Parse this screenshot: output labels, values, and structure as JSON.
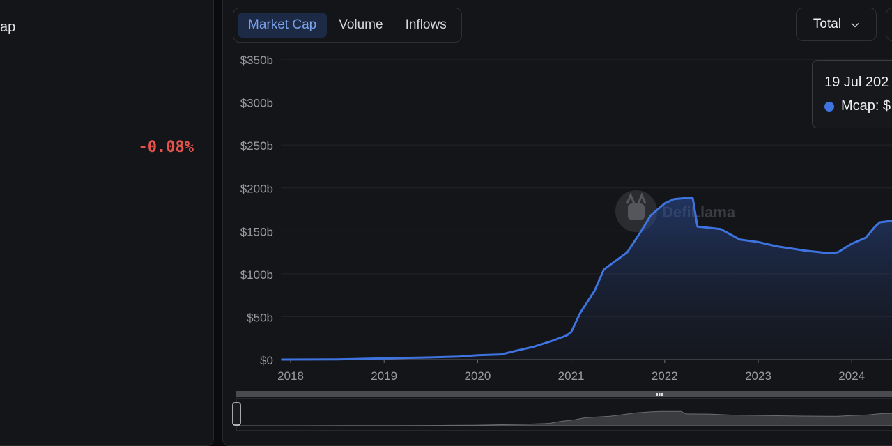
{
  "left": {
    "label": "ap",
    "change": "-0.08%"
  },
  "tabs": [
    {
      "label": "Market Cap",
      "active": true
    },
    {
      "label": "Volume",
      "active": false
    },
    {
      "label": "Inflows",
      "active": false
    }
  ],
  "total": {
    "label": "Total"
  },
  "tooltip": {
    "date": "19 Jul 202",
    "series": "Mcap: $"
  },
  "watermark": "DefiLlama",
  "colors": {
    "line": "#3e73e0",
    "negative": "#e5534b",
    "active_tab": "#7ba2ea"
  },
  "chart_data": {
    "type": "area",
    "yticks": [
      "$0",
      "$50b",
      "$100b",
      "$150b",
      "$200b",
      "$250b",
      "$300b",
      "$350b"
    ],
    "ylim": [
      0,
      350
    ],
    "xticks": [
      "2018",
      "2019",
      "2020",
      "2021",
      "2022",
      "2023",
      "2024"
    ],
    "xlim": [
      2017.9,
      2024.45
    ],
    "grid": true,
    "series": [
      {
        "x": [
          2017.9,
          2018.5,
          2019.0,
          2019.5,
          2019.8,
          2020.0,
          2020.25,
          2020.4,
          2020.6,
          2020.8,
          2020.95,
          2021.0,
          2021.1,
          2021.25,
          2021.35,
          2021.45,
          2021.6,
          2021.75,
          2021.85,
          2022.0,
          2022.1,
          2022.2,
          2022.3,
          2022.35,
          2022.6,
          2022.8,
          2023.0,
          2023.2,
          2023.5,
          2023.75,
          2023.85,
          2024.0,
          2024.15,
          2024.25,
          2024.3,
          2024.45
        ],
        "values": [
          0,
          0.2,
          1.5,
          2.5,
          3.5,
          5,
          6,
          10,
          15,
          22,
          28,
          32,
          55,
          80,
          105,
          113,
          125,
          150,
          168,
          182,
          187,
          188,
          188,
          155,
          152,
          140,
          137,
          132,
          127,
          124,
          125,
          135,
          142,
          155,
          160,
          162
        ]
      }
    ]
  }
}
